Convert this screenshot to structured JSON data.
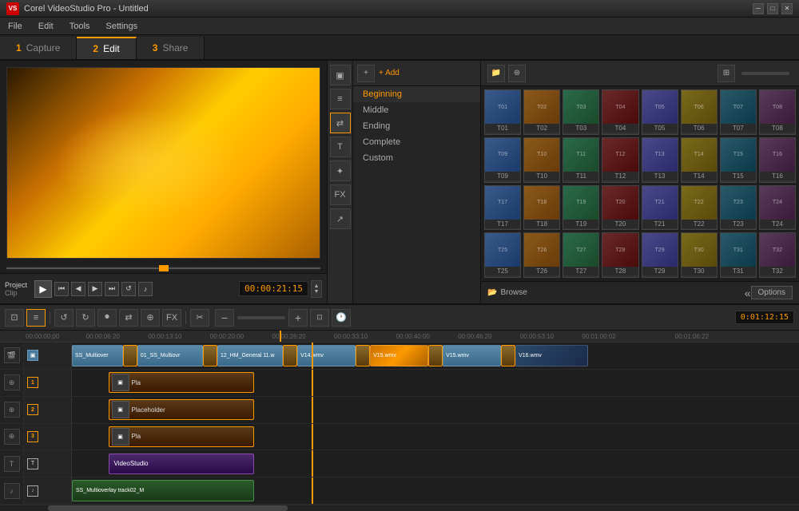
{
  "app": {
    "title": "Corel VideoStudio Pro - Untitled",
    "icon": "VS"
  },
  "menu": {
    "items": [
      "File",
      "Edit",
      "Tools",
      "Settings"
    ]
  },
  "tabs": [
    {
      "num": "1",
      "label": "Capture",
      "active": false
    },
    {
      "num": "2",
      "label": "Edit",
      "active": true
    },
    {
      "num": "3",
      "label": "Share",
      "active": false
    }
  ],
  "transition": {
    "add_label": "+ Add",
    "categories": [
      "Beginning",
      "Middle",
      "Ending",
      "Complete",
      "Custom"
    ]
  },
  "media": {
    "browse_label": "Browse",
    "options_label": "Options",
    "thumbnails": [
      {
        "id": "T01",
        "color_class": "tc1"
      },
      {
        "id": "T02",
        "color_class": "tc2"
      },
      {
        "id": "T03",
        "color_class": "tc3"
      },
      {
        "id": "T04",
        "color_class": "tc4"
      },
      {
        "id": "T05",
        "color_class": "tc5"
      },
      {
        "id": "T06",
        "color_class": "tc6"
      },
      {
        "id": "T07",
        "color_class": "tc7"
      },
      {
        "id": "T08",
        "color_class": "tc8"
      },
      {
        "id": "T09",
        "color_class": "tc2"
      },
      {
        "id": "T10",
        "color_class": "tc3"
      },
      {
        "id": "T11",
        "color_class": "tc4"
      },
      {
        "id": "T12",
        "color_class": "tc5"
      },
      {
        "id": "T13",
        "color_class": "tc6"
      },
      {
        "id": "T14",
        "color_class": "tc7"
      },
      {
        "id": "T15",
        "color_class": "tc8"
      },
      {
        "id": "T16",
        "color_class": "tc1"
      },
      {
        "id": "T17",
        "color_class": "tc5"
      },
      {
        "id": "T18",
        "color_class": "tc6"
      },
      {
        "id": "T19",
        "color_class": "tc7"
      },
      {
        "id": "T20",
        "color_class": "tc8"
      },
      {
        "id": "T21",
        "color_class": "tc1"
      },
      {
        "id": "T22",
        "color_class": "tc2"
      },
      {
        "id": "T23",
        "color_class": "tc3"
      },
      {
        "id": "T24",
        "color_class": "tc4"
      },
      {
        "id": "T25",
        "color_class": "tc7"
      },
      {
        "id": "T26",
        "color_class": "tc1"
      },
      {
        "id": "T27",
        "color_class": "tc2"
      },
      {
        "id": "T28",
        "color_class": "tc3"
      },
      {
        "id": "T29",
        "color_class": "tc4"
      },
      {
        "id": "T30",
        "color_class": "tc5"
      },
      {
        "id": "T31",
        "color_class": "tc6"
      },
      {
        "id": "T32",
        "color_class": "tc7"
      }
    ]
  },
  "preview": {
    "project_label": "Project",
    "clip_label": "Clip",
    "timecode": "00:00:21:15"
  },
  "timeline": {
    "timecode": "0:01:12:15",
    "timescale": [
      "00:00:00;00",
      "00:00:06:20",
      "00:00:13:10",
      "00:00:20:00",
      "00:00:26:20",
      "00:00:33:10",
      "00:00:40:00",
      "00:00:46:20",
      "00:00:53:10",
      "00:01:00:02",
      "00:01:06:22"
    ],
    "tracks": [
      {
        "type": "video",
        "clips": [
          {
            "label": "SS_Multiover",
            "start_pct": 0,
            "width_pct": 8
          },
          {
            "label": "",
            "start_pct": 8,
            "width_pct": 3
          },
          {
            "label": "01_SS_Multiovr",
            "start_pct": 11,
            "width_pct": 10
          },
          {
            "label": "",
            "start_pct": 21,
            "width_pct": 3
          },
          {
            "label": "12_HM_General 11.w",
            "start_pct": 24,
            "width_pct": 8
          },
          {
            "label": "",
            "start_pct": 32,
            "width_pct": 3
          },
          {
            "label": "V14.wmv",
            "start_pct": 35,
            "width_pct": 8
          },
          {
            "label": "",
            "start_pct": 43,
            "width_pct": 2
          },
          {
            "label": "V15.wmv",
            "start_pct": 45,
            "width_pct": 8
          },
          {
            "label": "",
            "start_pct": 53,
            "width_pct": 2
          },
          {
            "label": "V15.wmv",
            "start_pct": 55,
            "width_pct": 8
          },
          {
            "label": "",
            "start_pct": 63,
            "width_pct": 2
          },
          {
            "label": "V16.wmv",
            "start_pct": 65,
            "width_pct": 10
          }
        ]
      },
      {
        "type": "overlay1",
        "label": "Pla",
        "clips": [
          {
            "label": "Pla",
            "start_pct": 5,
            "width_pct": 20
          }
        ]
      },
      {
        "type": "overlay2",
        "label": "Placeholder",
        "clips": [
          {
            "label": "Placeholder",
            "start_pct": 5,
            "width_pct": 20
          }
        ]
      },
      {
        "type": "overlay3",
        "label": "Pla",
        "clips": [
          {
            "label": "Pla",
            "start_pct": 5,
            "width_pct": 20
          }
        ]
      },
      {
        "type": "title",
        "label": "VideoStudio",
        "clips": [
          {
            "label": "VideoStudio",
            "start_pct": 5,
            "width_pct": 20
          }
        ]
      },
      {
        "type": "audio",
        "label": "SS_Multioverlay track02_M",
        "clips": [
          {
            "label": "SS_Multioverlay track02_M",
            "start_pct": 0,
            "width_pct": 25
          }
        ]
      }
    ]
  }
}
